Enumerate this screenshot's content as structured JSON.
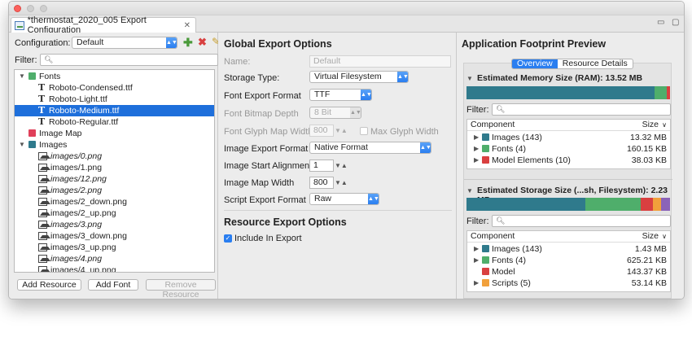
{
  "window": {
    "tab_title": "*thermostat_2020_005 Export Configuration"
  },
  "colors": {
    "teal": "#2f7a8c",
    "green": "#4fae6b",
    "red": "#d94040",
    "orange": "#f1a03b",
    "purple": "#8b63b8",
    "accent": "#2a7ef0"
  },
  "left": {
    "configuration_label": "Configuration:",
    "configuration_value": "Default",
    "filter_label": "Filter:",
    "tree": [
      {
        "label": "Fonts",
        "type": "group",
        "color": "#4fae6b"
      },
      {
        "label": "Roboto-Condensed.ttf",
        "type": "font"
      },
      {
        "label": "Roboto-Light.ttf",
        "type": "font"
      },
      {
        "label": "Roboto-Medium.ttf",
        "type": "font"
      },
      {
        "label": "Roboto-Regular.ttf",
        "type": "font"
      },
      {
        "label": "Image Map",
        "type": "group",
        "color": "#e0405a"
      },
      {
        "label": "Images",
        "type": "group",
        "color": "#2f7a8c"
      },
      {
        "label": "images/0.png",
        "type": "image"
      },
      {
        "label": "images/1.png",
        "type": "image"
      },
      {
        "label": "images/12.png",
        "type": "image"
      },
      {
        "label": "images/2.png",
        "type": "image"
      },
      {
        "label": "images/2_down.png",
        "type": "image"
      },
      {
        "label": "images/2_up.png",
        "type": "image"
      },
      {
        "label": "images/3.png",
        "type": "image"
      },
      {
        "label": "images/3_down.png",
        "type": "image"
      },
      {
        "label": "images/3_up.png",
        "type": "image"
      },
      {
        "label": "images/4.png",
        "type": "image"
      },
      {
        "label": "images/4_up.png",
        "type": "image"
      }
    ],
    "buttons": {
      "add_resource": "Add Resource",
      "add_font": "Add Font",
      "remove_resource": "Remove Resource"
    }
  },
  "mid": {
    "title": "Global Export Options",
    "name_label": "Name:",
    "name_placeholder": "Default",
    "storage_type_label": "Storage Type:",
    "storage_type_value": "Virtual Filesystem",
    "font_export_format_label": "Font Export Format",
    "font_export_format_value": "TTF",
    "font_bitmap_depth_label": "Font Bitmap Depth",
    "font_bitmap_depth_value": "8 Bit",
    "font_glyph_map_width_label": "Font Glyph Map Width",
    "font_glyph_map_width_value": "800",
    "max_glyph_width_label": "Max Glyph Width",
    "image_export_format_label": "Image Export Format",
    "image_export_format_value": "Native Format",
    "image_start_alignment_label": "Image Start Alignment:",
    "image_start_alignment_value": "1",
    "image_map_width_label": "Image Map Width",
    "image_map_width_value": "800",
    "script_export_format_label": "Script Export Format",
    "script_export_format_value": "Raw",
    "resource_title": "Resource Export Options",
    "include_in_export_label": "Include In Export"
  },
  "right": {
    "title": "Application Footprint Preview",
    "tabs": [
      "Overview",
      "Resource Details"
    ],
    "memory": {
      "heading": "Estimated Memory Size (RAM): 13.52 MB",
      "filter_label": "Filter:",
      "col_component": "Component",
      "col_size": "Size",
      "bar": [
        0.925,
        0.06,
        0.015
      ],
      "rows": [
        {
          "name": "Images (143)",
          "size": "13.32 MB",
          "color": "#2f7a8c"
        },
        {
          "name": "Fonts (4)",
          "size": "160.15 KB",
          "color": "#4fae6b"
        },
        {
          "name": "Model Elements (10)",
          "size": "38.03 KB",
          "color": "#d94040"
        }
      ]
    },
    "storage": {
      "heading": "Estimated Storage Size (...sh, Filesystem): 2.23 MB",
      "filter_label": "Filter:",
      "col_component": "Component",
      "col_size": "Size",
      "bar": [
        0.585,
        0.27,
        0.06,
        0.04,
        0.045
      ],
      "rows": [
        {
          "name": "Images (143)",
          "size": "1.43 MB",
          "color": "#2f7a8c",
          "expandable": true
        },
        {
          "name": "Fonts (4)",
          "size": "625.21 KB",
          "color": "#4fae6b",
          "expandable": true
        },
        {
          "name": "Model",
          "size": "143.37 KB",
          "color": "#d94040",
          "expandable": false
        },
        {
          "name": "Scripts (5)",
          "size": "53.14 KB",
          "color": "#f1a03b",
          "expandable": true
        }
      ]
    }
  }
}
